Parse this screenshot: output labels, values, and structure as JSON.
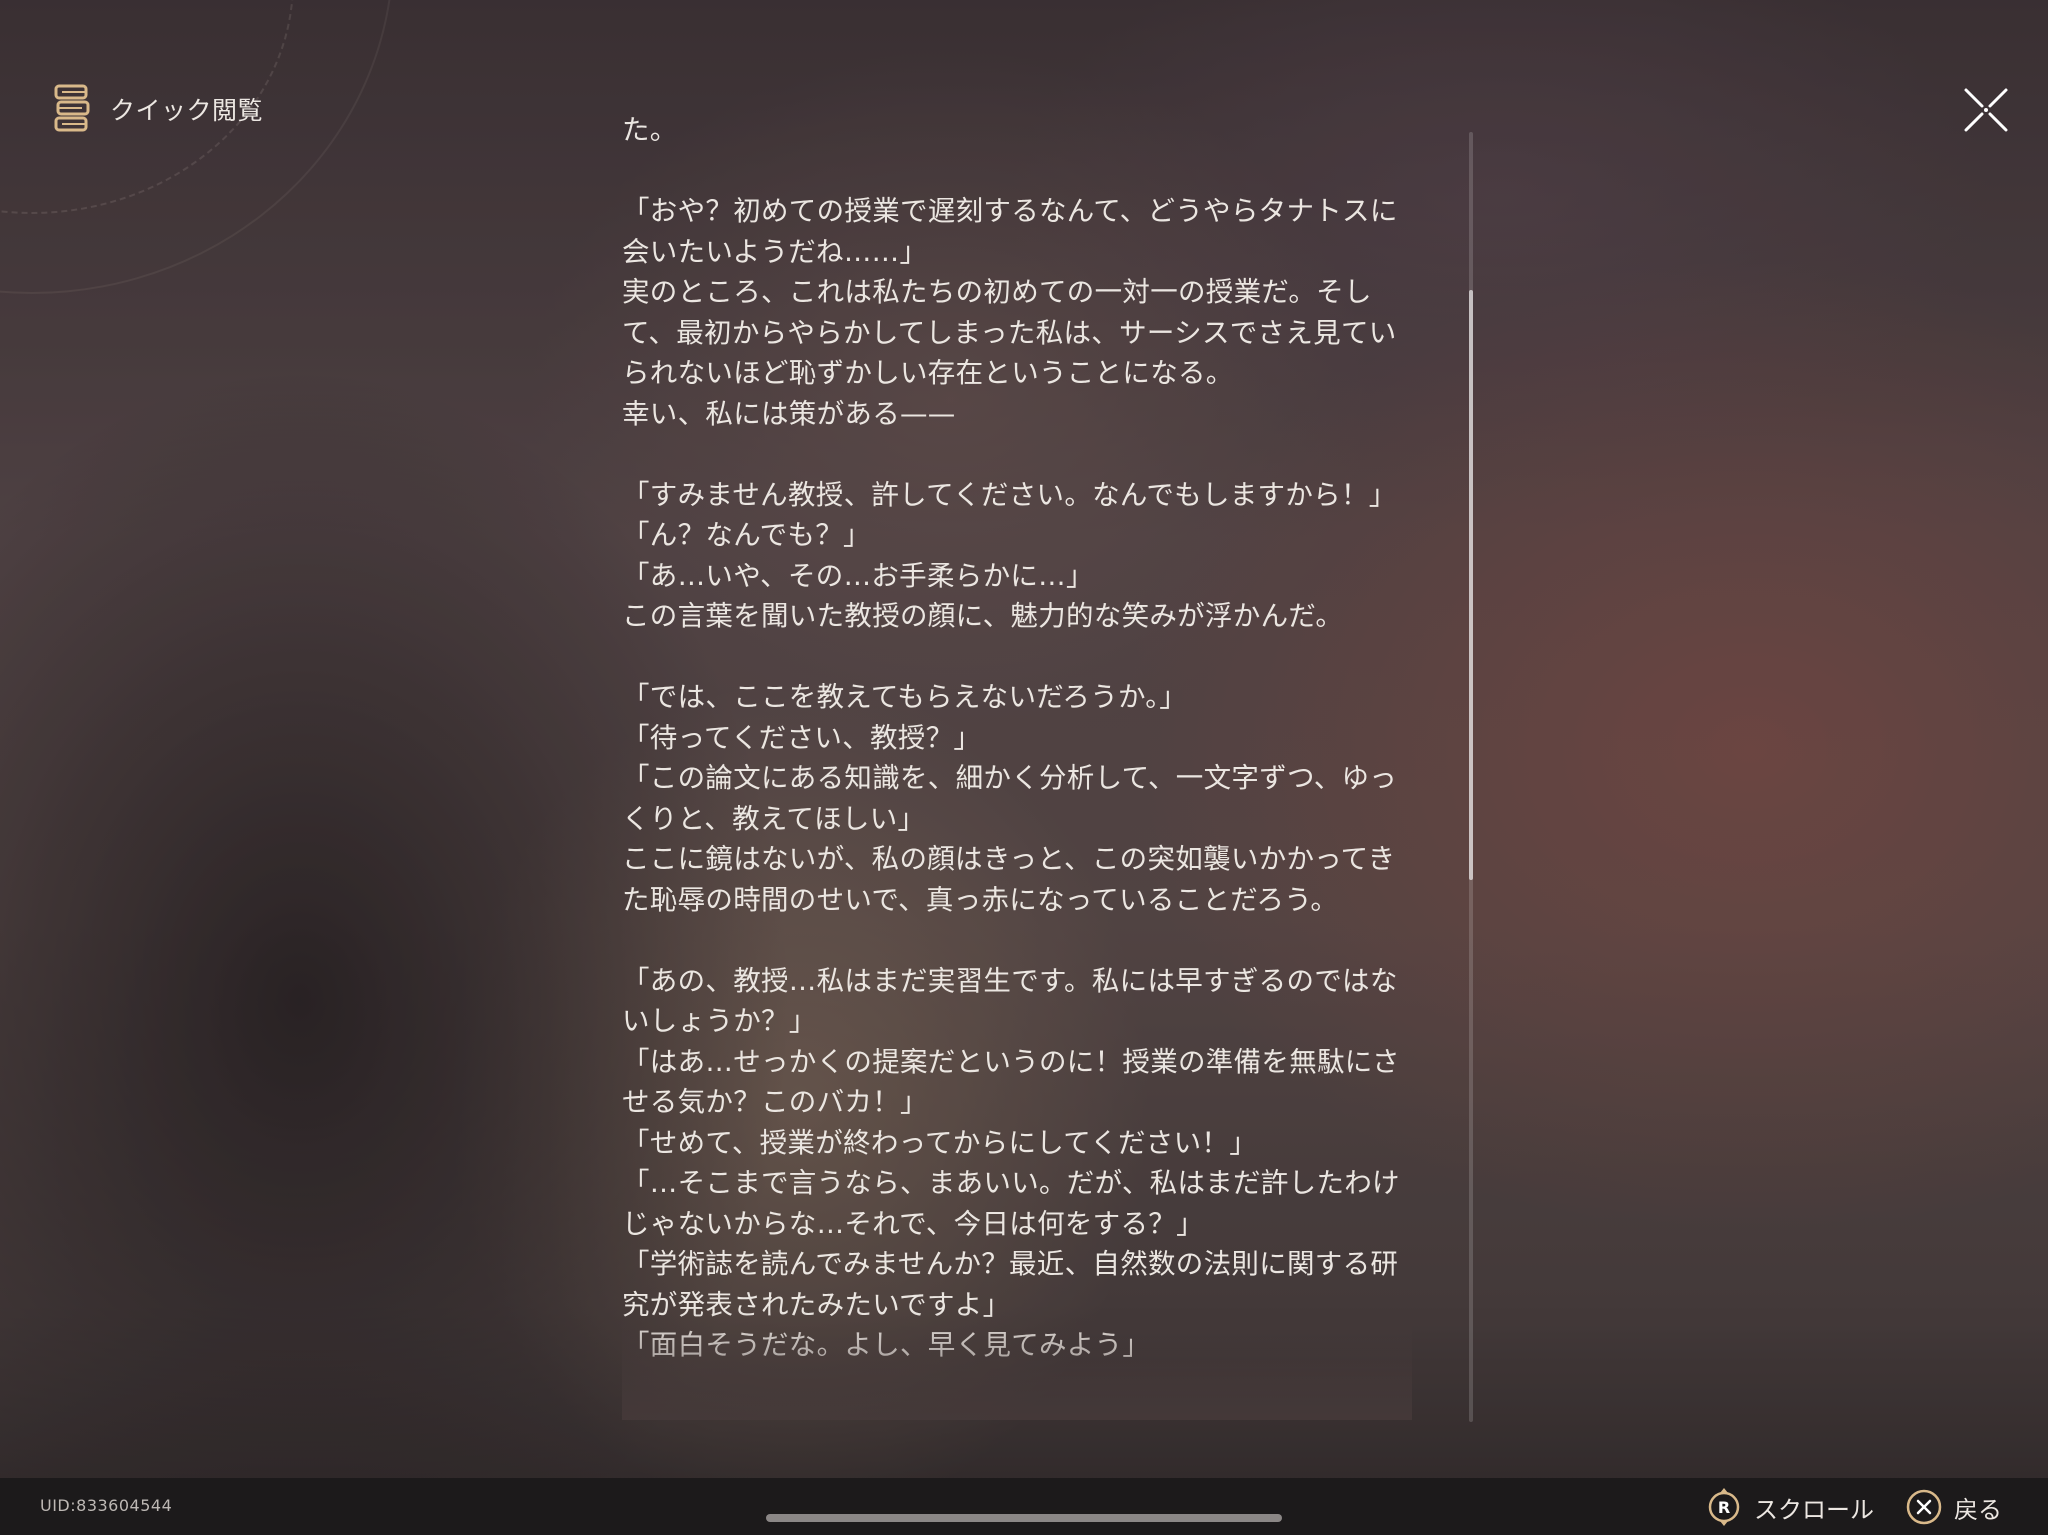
{
  "header": {
    "title": "クイック閲覧",
    "icon": "book-stack-icon"
  },
  "close": {
    "icon": "close-x-icon"
  },
  "reader": {
    "text": "た。\n\n「おや？初めての授業で遅刻するなんて、どうやらタナトスに会いたいようだね……」\n実のところ、これは私たちの初めての一対一の授業だ。そして、最初からやらかしてしまった私は、サーシスでさえ見ていられないほど恥ずかしい存在ということになる。\n幸い、私には策がある——\n\n「すみません教授、許してください。なんでもしますから！」\n「ん？なんでも？」\n「あ…いや、その…お手柔らかに…」\nこの言葉を聞いた教授の顔に、魅力的な笑みが浮かんだ。\n\n「では、ここを教えてもらえないだろうか。」\n「待ってください、教授？」\n「この論文にある知識を、細かく分析して、一文字ずつ、ゆっくりと、教えてほしい」\nここに鏡はないが、私の顔はきっと、この突如襲いかかってきた恥辱の時間のせいで、真っ赤になっていることだろう。\n\n「あの、教授…私はまだ実習生です。私には早すぎるのではないしょうか？」\n「はあ…せっかくの提案だというのに！授業の準備を無駄にさせる気か？このバカ！」\n「せめて、授業が終わってからにしてください！」\n「…そこまで言うなら、まあいい。だが、私はまだ許したわけじゃないからな…それで、今日は何をする？」\n「学術誌を読んでみませんか？最近、自然数の法則に関する研究が発表されたみたいですよ」\n「面白そうだな。よし、早く見てみよう」"
  },
  "footer": {
    "uid": "UID:833604544",
    "scroll_button": "R",
    "scroll_label": "スクロール",
    "back_label": "戻る"
  },
  "colors": {
    "accent_gold": "#d9b98a",
    "text": "#ebe6e1",
    "bar": "#1c1a1b"
  }
}
